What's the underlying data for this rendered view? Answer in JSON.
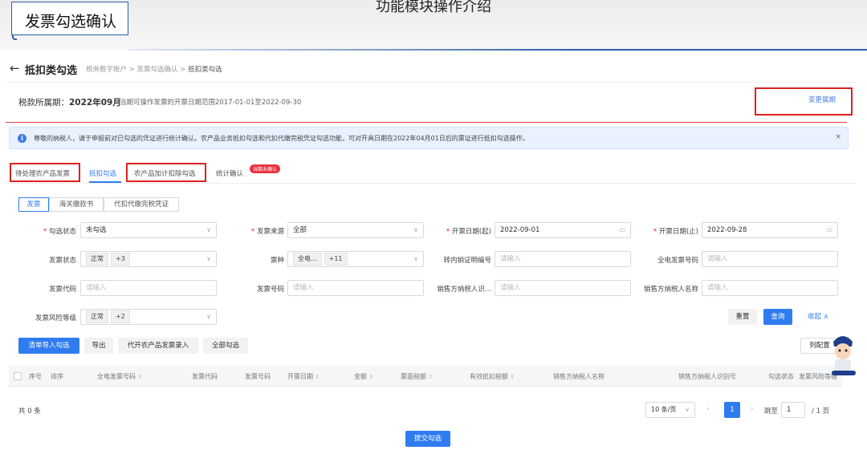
{
  "slide": {
    "title": "功能模块操作介绍",
    "badge": "发票勾选确认"
  },
  "header": {
    "back": "←",
    "title": "抵扣类勾选",
    "breadcrumb": [
      "税务数字账户",
      "发票勾选确认",
      "抵扣类勾选"
    ]
  },
  "period": {
    "label": "税款所属期：",
    "value": "2022年09月",
    "range": "当期可操作发票的开票日期范围2017-01-01至2022-09-30",
    "change": "变更属期"
  },
  "notice": {
    "text": "尊敬的纳税人，请于申报前对已勾选的凭证进行统计确认。农产品业务抵扣勾选和代扣代缴完税凭证勾选功能，可对开具日期在2022年04月01日后的票证进行抵扣勾选操作。",
    "close": "×"
  },
  "tabs": [
    {
      "label": "待处理农产品发票"
    },
    {
      "label": "抵扣勾选"
    },
    {
      "label": "农产品加计扣除勾选"
    },
    {
      "label": "统计确认"
    }
  ],
  "tab_badge": "当期未确认",
  "segments": [
    "发票",
    "海关缴款书",
    "代扣代缴完税凭证"
  ],
  "form": {
    "status": {
      "label": "勾选状态",
      "value": "未勾选"
    },
    "source": {
      "label": "发票来源",
      "value": "全部"
    },
    "date_from": {
      "label": "开票日期(起)",
      "value": "2022-09-01"
    },
    "date_to": {
      "label": "开票日期(止)",
      "value": "2022-09-28"
    },
    "invoice_status": {
      "label": "发票状态",
      "tag": "正常",
      "more": "+3"
    },
    "kind": {
      "label": "票种",
      "tag": "全电...",
      "more": "+11"
    },
    "transfer": {
      "label": "转内销证明编号",
      "placeholder": "请输入"
    },
    "full_number": {
      "label": "全电发票号码",
      "placeholder": "请输入"
    },
    "code": {
      "label": "发票代码",
      "placeholder": "请输入"
    },
    "number": {
      "label": "发票号码",
      "placeholder": "请输入"
    },
    "seller_id": {
      "label": "销售方纳税人识...",
      "placeholder": "请输入"
    },
    "seller_name": {
      "label": "销售方纳税人名称",
      "placeholder": "请输入"
    },
    "risk": {
      "label": "发票风险等级",
      "tag": "正常",
      "more": "+2"
    }
  },
  "buttons": {
    "reset": "重置",
    "query": "查询",
    "collapse": "收起 ∧",
    "import": "清单导入勾选",
    "export": "导出",
    "agri": "代开农产品发票录入",
    "all": "全部勾选",
    "columns": "列配置",
    "submit": "提交勾选"
  },
  "table": {
    "headers": [
      "序号",
      "排序",
      "全电发票号码",
      "发票代码",
      "发票号码",
      "开票日期",
      "金额",
      "票面税额",
      "有效抵扣税额",
      "销售方纳税人名称",
      "销售方纳税人识别号",
      "勾选状态",
      "发票风险等级"
    ]
  },
  "pagination": {
    "total": "共 0 条",
    "size": "10 条/页",
    "page": "1",
    "goto": "跳至",
    "goto_value": "1",
    "pages": "/ 1 页"
  },
  "colors": {
    "primary": "#2f7cf0",
    "highlight": "#e02020"
  }
}
